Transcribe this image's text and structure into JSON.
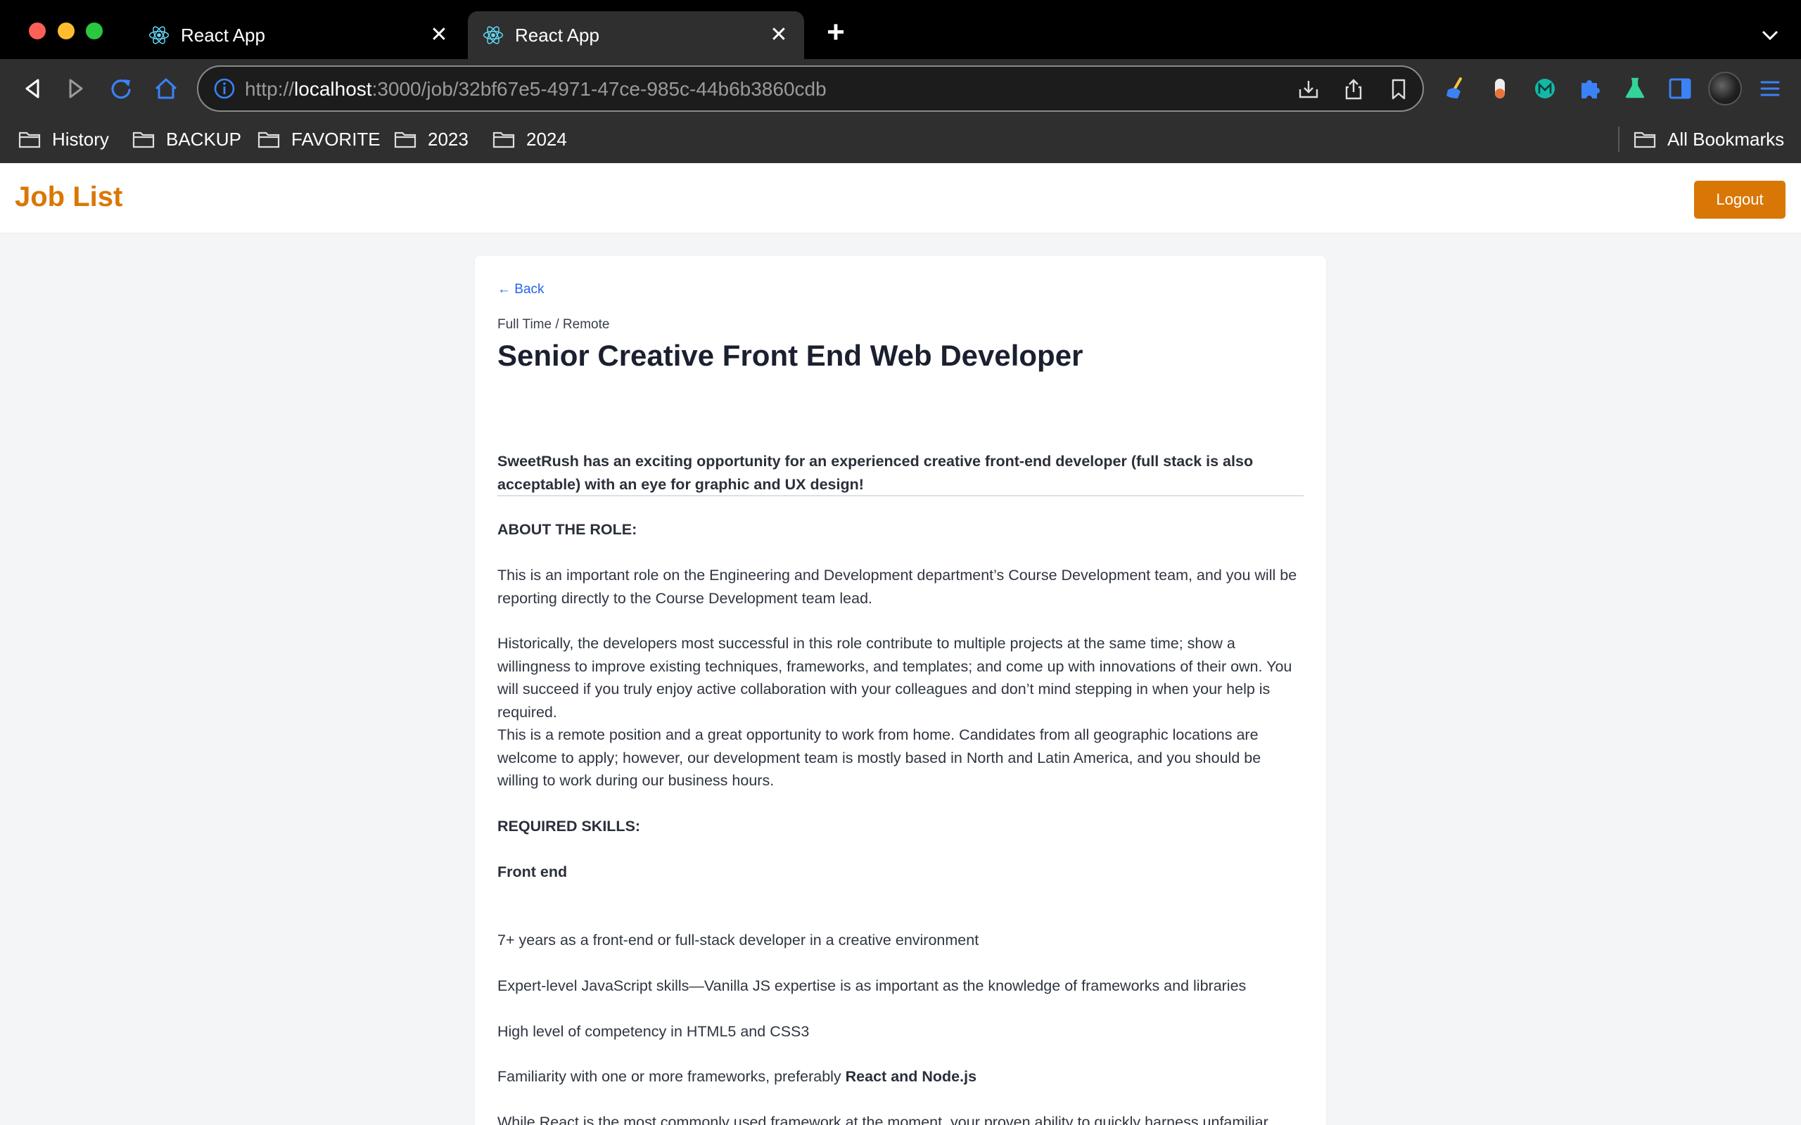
{
  "browser": {
    "tabs": [
      {
        "title": "React App",
        "active": false
      },
      {
        "title": "React App",
        "active": true
      }
    ],
    "url_scheme": "http://",
    "url_host": "localhost",
    "url_rest": ":3000/job/32bf67e5-4971-47ce-985c-44b6b3860cdb",
    "bookmarks": [
      "History",
      "BACKUP",
      "FAVORITE",
      "2023",
      "2024"
    ],
    "all_bookmarks": "All Bookmarks"
  },
  "header": {
    "brand": "Job List",
    "logout": "Logout"
  },
  "job": {
    "back": "← Back",
    "meta": "Full Time / Remote",
    "title": "Senior Creative Front End Web Developer",
    "intro": "SweetRush has an exciting opportunity for an experienced creative front-end developer (full stack is also acceptable) with an eye for graphic and UX design!",
    "about_heading": "ABOUT THE ROLE:",
    "about_p1": "This is an important role on the Engineering and Development department’s Course Development team, and you will be reporting directly to the Course Development team lead.",
    "about_p2": "Historically, the developers most successful in this role contribute to multiple projects at the same time; show a willingness to improve existing techniques, frameworks, and templates; and come up with innovations of their own. You will succeed if you truly enjoy active collaboration with your colleagues and don’t mind stepping in when your help is required.",
    "about_p3": "This is a remote position and a great opportunity to work from home. Candidates from all geographic locations are welcome to apply; however, our development team is mostly based in North and Latin America, and you should be willing to work during our business hours.",
    "skills_heading": "REQUIRED SKILLS:",
    "frontend_heading": "Front end",
    "skill_1": "7+ years as a front-end or full-stack developer in a creative environment",
    "skill_2": "Expert-level JavaScript skills—Vanilla JS expertise is as important as the knowledge of frameworks and libraries",
    "skill_3": "High level of competency in HTML5 and CSS3",
    "skill_4_prefix": "Familiarity with one or more frameworks, preferably ",
    "skill_4_bold": "React and Node.js",
    "skill_5": "While React is the most commonly used framework at the moment, your proven ability to quickly harness unfamiliar"
  }
}
